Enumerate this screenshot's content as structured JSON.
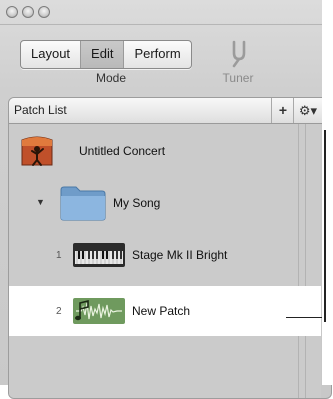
{
  "toolbar": {
    "modes": [
      {
        "label": "Layout",
        "active": false
      },
      {
        "label": "Edit",
        "active": true
      },
      {
        "label": "Perform",
        "active": false
      }
    ],
    "mode_caption": "Mode",
    "tuner_label": "Tuner"
  },
  "patch_list": {
    "title": "Patch List",
    "add_symbol": "+",
    "action_symbol": "⚙▾",
    "items": [
      {
        "type": "concert",
        "name": "Untitled Concert",
        "icon": "concert-icon"
      },
      {
        "type": "song",
        "name": "My Song",
        "icon": "folder-icon",
        "disclosure": "▼"
      },
      {
        "type": "patch",
        "number": "1",
        "name": "Stage Mk II Bright",
        "icon": "keyboard-icon"
      },
      {
        "type": "patch",
        "number": "2",
        "name": "New Patch",
        "icon": "audio-waveform-icon",
        "selected": true
      }
    ]
  },
  "colors": {
    "selected_row": "#ffffff",
    "concert_icon": "#c0502a",
    "folder_icon": "#7aa6d4",
    "patch_icon": "#6f9a5e"
  }
}
